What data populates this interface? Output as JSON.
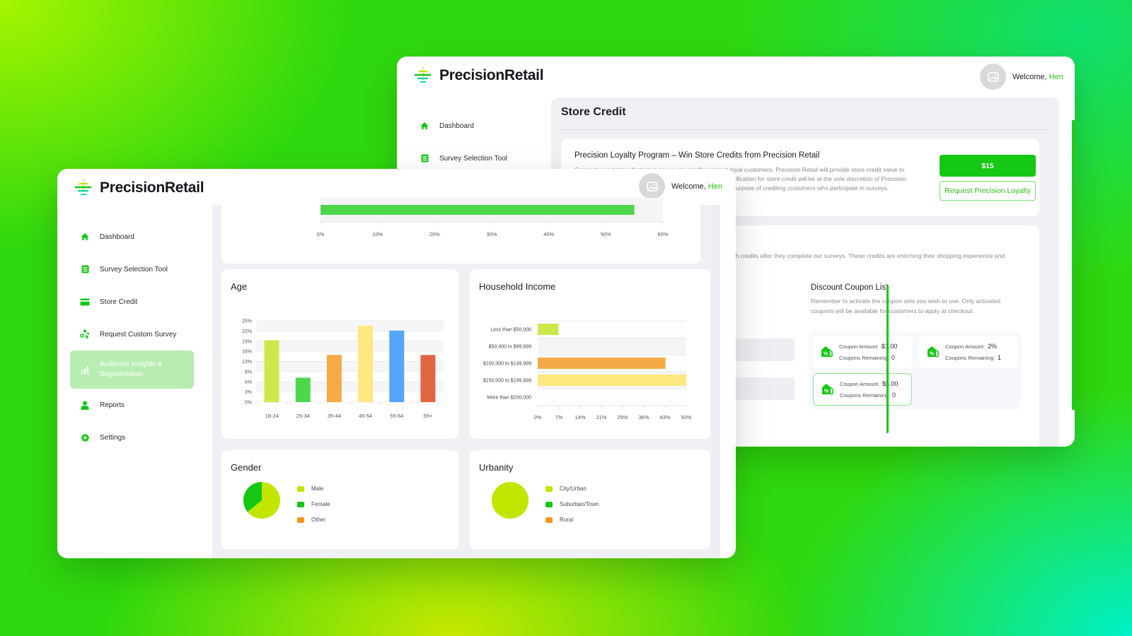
{
  "brand": {
    "name": "PrecisionRetail",
    "accent": "#14c814"
  },
  "user": {
    "welcome_prefix": "Welcome,",
    "name": "Hen"
  },
  "nav": {
    "items": [
      {
        "label": "Dashboard",
        "icon": "home-icon"
      },
      {
        "label": "Survey Selection Tool",
        "icon": "clipboard-list-icon"
      },
      {
        "label": "Store Credit",
        "icon": "credit-card-icon"
      },
      {
        "label": "Request Custom Survey",
        "icon": "nodes-pointer-icon"
      },
      {
        "label": "Audience Insights & Segmentation",
        "icon": "bar-chart-icon",
        "active": true
      },
      {
        "label": "Reports",
        "icon": "user-icon"
      },
      {
        "label": "Settings",
        "icon": "gear-icon"
      }
    ]
  },
  "store_credit": {
    "title": "Store Credit",
    "loyalty": {
      "title": "Precision Loyalty Program – Win Store Credits from Precision Retail",
      "description": "Connect your bank information so we can credit our most loyal customers. Precision Retail will provide store credit value to customers who participate in Precision Retail Surveys. Qualification for store credit will be at the sole discretion of Precision Retail. Data will be securely stored and used solely for the purpose of crediting customers who participate in surveys.",
      "credit_value": "$15",
      "request_label": "Request Precision Loyalty"
    },
    "coupons_intro": "Offer your customers exclusive savings by providing them with credits after they complete our surveys. These credits are enriching their shopping experience and incentivizing future purchases.",
    "coupon_list": {
      "title": "Discount Coupon List",
      "description": "Remember to activate the coupon sets you wish to use. Only activated coupons will be available for customers to apply at checkout.",
      "amount_label": "Coupon Amount:",
      "remaining_label": "Coupons Remaining:",
      "coupons": [
        {
          "amount": "$1.00",
          "remaining": "0",
          "active": false
        },
        {
          "amount": "2%",
          "remaining": "1",
          "active": false
        },
        {
          "amount": "$5.00",
          "remaining": "0",
          "active": true
        }
      ]
    }
  },
  "chart_data": [
    {
      "id": "top-partial",
      "type": "bar",
      "orientation": "horizontal",
      "title": "",
      "categories": [
        ""
      ],
      "values": [
        55
      ],
      "xlim": [
        0,
        60
      ],
      "x_ticks": [
        "0%",
        "10%",
        "20%",
        "30%",
        "40%",
        "50%",
        "60%"
      ],
      "colors": [
        "#4cd84a"
      ]
    },
    {
      "id": "age",
      "type": "bar",
      "title": "Age",
      "categories": [
        "18-24",
        "25-34",
        "35-44",
        "45-54",
        "55-64",
        "65+"
      ],
      "values": [
        19,
        7.5,
        14.5,
        23.5,
        22,
        14.5
      ],
      "ylim": [
        0,
        25
      ],
      "y_ticks": [
        "0%",
        "3%",
        "6%",
        "9%",
        "13%",
        "16%",
        "19%",
        "22%",
        "25%"
      ],
      "colors": [
        "#cbe94a",
        "#4cd84a",
        "#f5a947",
        "#fde980",
        "#55a6f9",
        "#e26541"
      ],
      "grid": true
    },
    {
      "id": "household-income",
      "type": "bar",
      "orientation": "horizontal",
      "title": "Household Income",
      "categories": [
        "Less than $50,000",
        "$50,000 to $99,999",
        "$100,000 to $149,999",
        "$150,000 to $199,999",
        "More than $200,000"
      ],
      "values": [
        7,
        0,
        43,
        50,
        0
      ],
      "xlim": [
        0,
        50
      ],
      "x_ticks": [
        "0%",
        "7%",
        "14%",
        "21%",
        "29%",
        "36%",
        "43%",
        "50%"
      ],
      "colors": [
        "#cbe94a",
        "#4cd84a",
        "#f5a947",
        "#fde980",
        "#55a6f9"
      ],
      "grid": true
    },
    {
      "id": "gender",
      "type": "pie",
      "title": "Gender",
      "categories": [
        "Male",
        "Female",
        "Other"
      ],
      "values": [
        64,
        36,
        0
      ],
      "colors": [
        "#c3e600",
        "#14c814",
        "#f5961e"
      ],
      "legend": "right"
    },
    {
      "id": "urbanity",
      "type": "pie",
      "title": "Urbanity",
      "categories": [
        "City/Urban",
        "Suburban/Town",
        "Rural"
      ],
      "values": [
        100,
        0,
        0
      ],
      "colors": [
        "#c3e600",
        "#14c814",
        "#f5961e"
      ],
      "legend": "right"
    }
  ]
}
